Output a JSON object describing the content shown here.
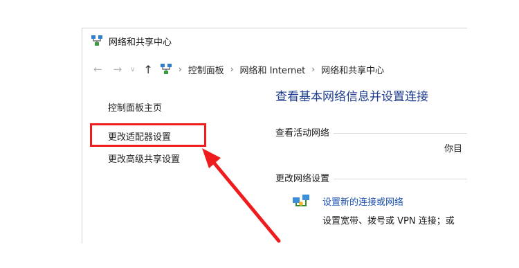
{
  "window": {
    "title": "网络和共享中心"
  },
  "address_bar": {
    "crumbs": [
      "控制面板",
      "网络和 Internet",
      "网络和共享中心"
    ]
  },
  "left_pane": {
    "home_link": "控制面板主页",
    "adapter_link": "更改适配器设置",
    "sharing_link": "更改高级共享设置"
  },
  "main": {
    "title": "查看基本网络信息并设置连接",
    "active_networks_header": "查看活动网络",
    "active_network_clipped": "你目",
    "change_settings_header": "更改网络设置",
    "setup_link": "设置新的连接或网络",
    "setup_desc": "设置宽带、拨号或 VPN 连接；或"
  },
  "annotation": {
    "color": "#ee1c1c"
  }
}
